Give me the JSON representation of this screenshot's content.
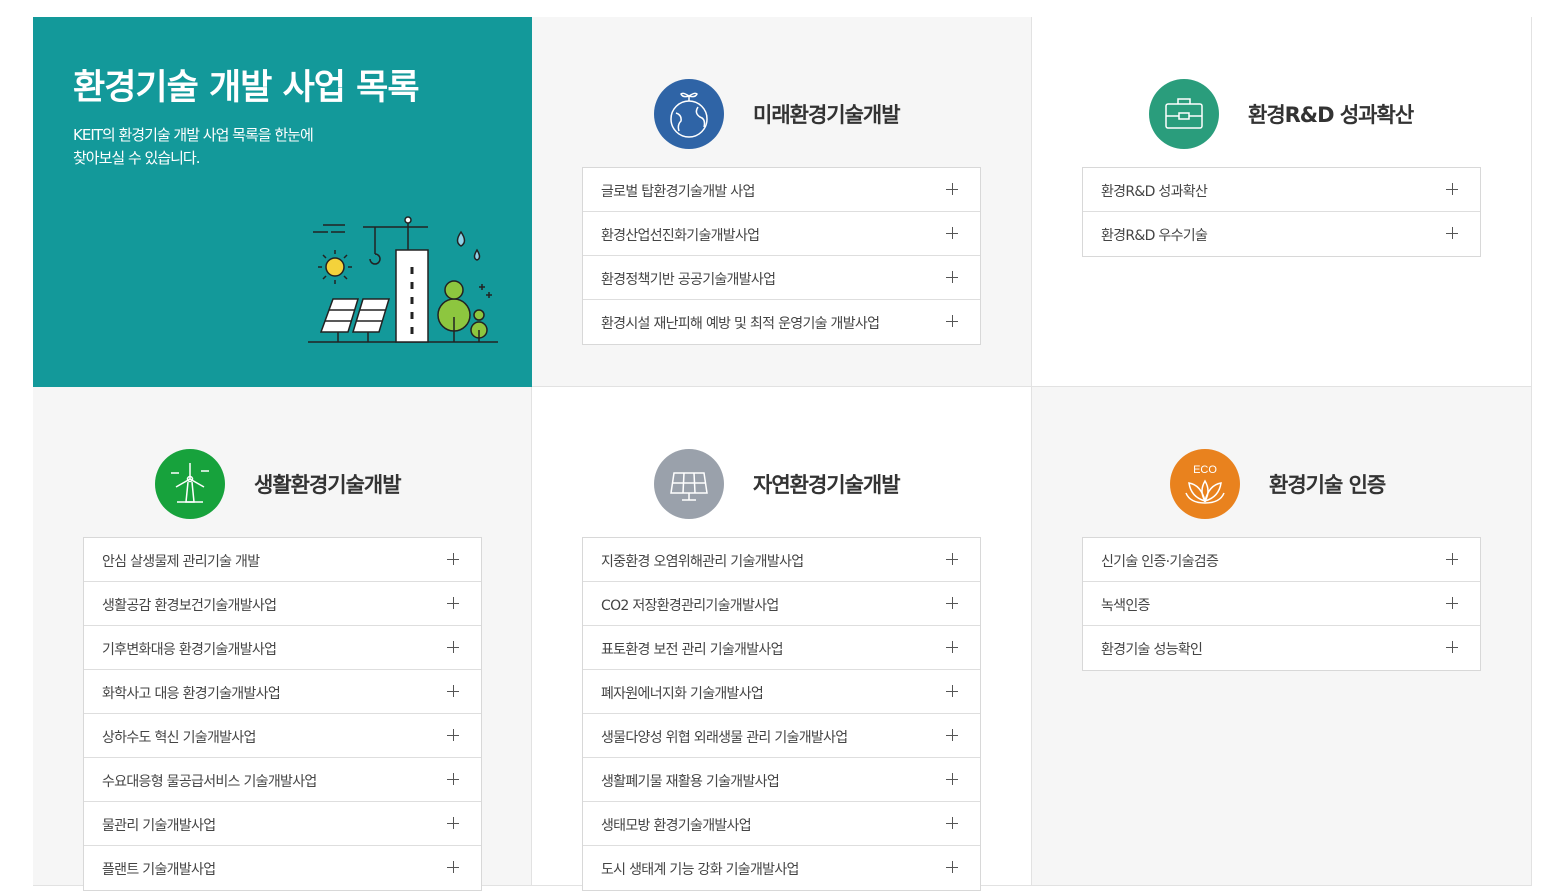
{
  "intro": {
    "title": "환경기술 개발 사업 목록",
    "desc_line1": "KEIT의 환경기술 개발 사업 목록을 한눈에",
    "desc_line2": "찾아보실 수 있습니다."
  },
  "categories": [
    {
      "title": "미래환경기술개발",
      "icon": "earth-sprout-icon",
      "color": "#2f64a6",
      "items": [
        "글로벌 탑환경기술개발 사업",
        "환경산업선진화기술개발사업",
        "환경정책기반 공공기술개발사업",
        "환경시설 재난피해 예방 및 최적 운영기술 개발사업"
      ]
    },
    {
      "title": "환경R&D 성과확산",
      "icon": "briefcase-icon",
      "color": "#2a9d7c",
      "items": [
        "환경R&D 성과확산",
        "환경R&D 우수기술"
      ]
    },
    {
      "title": "생활환경기술개발",
      "icon": "wind-turbine-icon",
      "color": "#17a23c",
      "items": [
        "안심 살생물제 관리기술 개발",
        "생활공감 환경보건기술개발사업",
        "기후변화대응 환경기술개발사업",
        "화학사고 대응 환경기술개발사업",
        "상하수도 혁신 기술개발사업",
        "수요대응형 물공급서비스 기술개발사업",
        "물관리 기술개발사업",
        "플랜트 기술개발사업"
      ]
    },
    {
      "title": "자연환경기술개발",
      "icon": "solar-panel-icon",
      "color": "#9aa1ab",
      "items": [
        "지중환경 오염위해관리 기술개발사업",
        "CO2 저장환경관리기술개발사업",
        "표토환경 보전 관리 기술개발사업",
        "폐자원에너지화 기술개발사업",
        "생물다양성 위협 외래생물 관리 기술개발사업",
        "생활폐기물 재활용 기술개발사업",
        "생태모방 환경기술개발사업",
        "도시 생태계 기능 강화 기술개발사업"
      ]
    },
    {
      "title": "환경기술 인증",
      "icon": "eco-leaf-icon",
      "icon_text": "ECO",
      "color": "#e9821e",
      "items": [
        "신기술 인증·기술검증",
        "녹색인증",
        "환경기술 성능확인"
      ]
    }
  ]
}
